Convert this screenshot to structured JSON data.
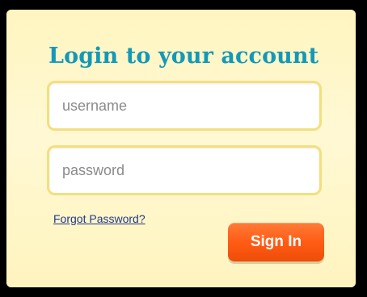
{
  "login": {
    "title": "Login to your account",
    "username_placeholder": "username",
    "password_placeholder": "password",
    "forgot_password": "Forgot Password?",
    "sign_in": "Sign In"
  },
  "colors": {
    "panel_background": "#fff7c8",
    "title_color": "#1498b8",
    "field_border": "#f3df7e",
    "link_color": "#20378b",
    "button_orange": "#ff5b14"
  }
}
